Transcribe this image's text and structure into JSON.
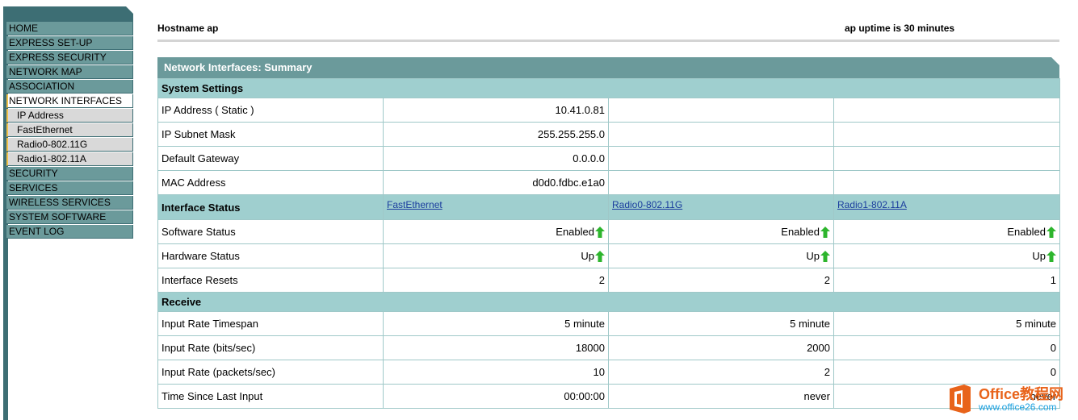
{
  "nav": {
    "items": [
      {
        "label": "HOME",
        "kind": "main"
      },
      {
        "label": "EXPRESS SET-UP",
        "kind": "main"
      },
      {
        "label": "EXPRESS SECURITY",
        "kind": "main"
      },
      {
        "label": "NETWORK MAP",
        "kind": "main"
      },
      {
        "label": "ASSOCIATION",
        "kind": "main"
      },
      {
        "label": "NETWORK INTERFACES",
        "kind": "active"
      },
      {
        "label": "IP Address",
        "kind": "sub"
      },
      {
        "label": "FastEthernet",
        "kind": "sub"
      },
      {
        "label": "Radio0-802.11G",
        "kind": "sub"
      },
      {
        "label": "Radio1-802.11A",
        "kind": "sub"
      },
      {
        "label": "SECURITY",
        "kind": "main"
      },
      {
        "label": "SERVICES",
        "kind": "main"
      },
      {
        "label": "WIRELESS SERVICES",
        "kind": "main"
      },
      {
        "label": "SYSTEM SOFTWARE",
        "kind": "main"
      },
      {
        "label": "EVENT LOG",
        "kind": "main"
      }
    ]
  },
  "header": {
    "hostname": "Hostname  ap",
    "uptime": "ap uptime is 30 minutes"
  },
  "panel": {
    "title": "Network Interfaces: Summary",
    "system_settings": {
      "heading": "System Settings",
      "rows": [
        {
          "label": "IP Address ( Static )",
          "value": "10.41.0.81"
        },
        {
          "label": "IP Subnet Mask",
          "value": "255.255.255.0"
        },
        {
          "label": "Default Gateway",
          "value": "0.0.0.0"
        },
        {
          "label": "MAC Address",
          "value": "d0d0.fdbc.e1a0"
        }
      ]
    },
    "interface_status": {
      "heading": "Interface Status",
      "interfaces": [
        "FastEthernet",
        "Radio0-802.11G",
        "Radio1-802.11A"
      ],
      "rows": [
        {
          "label": "Software Status",
          "values": [
            "Enabled",
            "Enabled",
            "Enabled"
          ],
          "arrow": true
        },
        {
          "label": "Hardware Status",
          "values": [
            "Up",
            "Up",
            "Up"
          ],
          "arrow": true
        },
        {
          "label": "Interface Resets",
          "values": [
            "2",
            "2",
            "1"
          ],
          "arrow": false
        }
      ]
    },
    "receive": {
      "heading": "Receive",
      "rows": [
        {
          "label": "Input Rate Timespan",
          "values": [
            "5 minute",
            "5 minute",
            "5 minute"
          ]
        },
        {
          "label": "Input Rate (bits/sec)",
          "values": [
            "18000",
            "2000",
            "0"
          ]
        },
        {
          "label": "Input Rate (packets/sec)",
          "values": [
            "10",
            "2",
            "0"
          ]
        },
        {
          "label": "Time Since Last Input",
          "values": [
            "00:00:00",
            "never",
            "never"
          ]
        }
      ]
    }
  },
  "watermark": {
    "brand": "Office教程网",
    "url": "www.office26.com"
  },
  "colors": {
    "nav_bg": "#6b9a9b",
    "nav_dark": "#3d6e74",
    "section_bg": "#9fcfcf",
    "status_up_arrow": "#2db52d",
    "link": "#1a3d9e"
  },
  "icons": {
    "status_arrow": "green-up-arrow-icon"
  }
}
